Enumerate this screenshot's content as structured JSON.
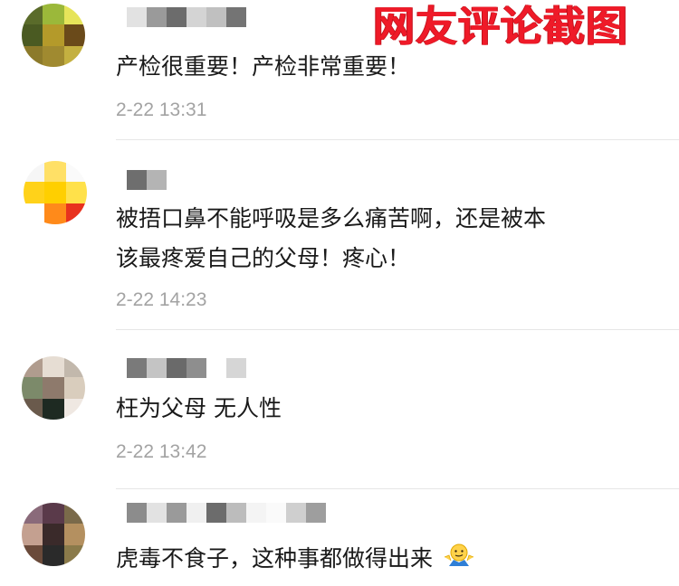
{
  "watermark": "网友评论截图",
  "comments": [
    {
      "text": "产检很重要！产检非常重要！",
      "time": "2-22 13:31"
    },
    {
      "text_line1": "被捂口鼻不能呼吸是多么痛苦啊，还是被本",
      "text_line2": "该最疼爱自己的父母！疼心！",
      "time": "2-22 14:23"
    },
    {
      "text": "枉为父母 无人性",
      "time": "2-22 13:42"
    },
    {
      "text": "虎毒不食子，这种事都做得出来",
      "emoji": "shrug-emoji"
    }
  ],
  "colors": {
    "watermark": "#ef1a28",
    "text": "#1a1a1a",
    "time": "#a3a3a3",
    "divider": "#e6e6e6"
  }
}
